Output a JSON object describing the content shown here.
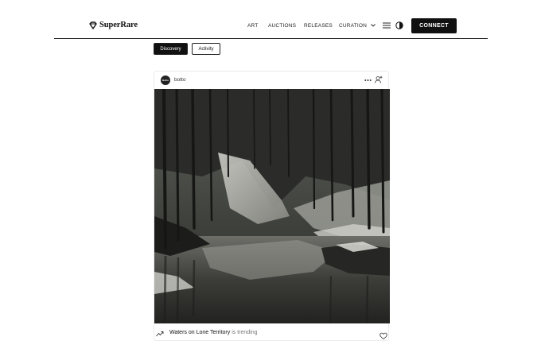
{
  "brand": {
    "name": "SuperRare"
  },
  "nav": {
    "items": [
      "ART",
      "AUCTIONS",
      "RELEASES",
      "CURATION"
    ],
    "connect_label": "CONNECT"
  },
  "tabs": [
    {
      "label": "Discovery",
      "active": true
    },
    {
      "label": "Activity",
      "active": false
    }
  ],
  "card": {
    "avatar_text": "Botto",
    "artist": "botto",
    "artwork_description": "Forest stream reflection, black and white",
    "trending": {
      "title": "Waters on Lone Territory",
      "suffix": "is trending"
    }
  },
  "icons": {
    "logo": "diamond-logo-icon",
    "menu": "menu-icon",
    "theme": "contrast-icon",
    "more": "more-icon",
    "follow": "follow-icon",
    "trend": "trending-icon",
    "like": "heart-icon"
  },
  "colors": {
    "primary": "#111111",
    "background": "#ffffff",
    "muted": "#777777"
  }
}
